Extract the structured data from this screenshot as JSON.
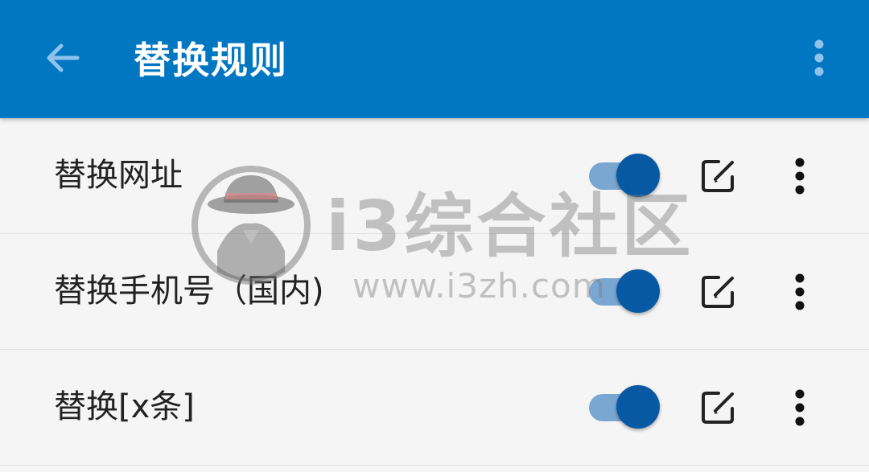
{
  "appbar": {
    "title": "替换规则",
    "back_icon": "arrow-left-icon",
    "overflow_icon": "more-vertical-icon",
    "color": "#0277c1"
  },
  "rules": [
    {
      "label": "替换网址",
      "enabled": true
    },
    {
      "label": "替换手机号（国内)",
      "enabled": true
    },
    {
      "label": "替换[x条]",
      "enabled": true
    }
  ],
  "row_icons": {
    "edit_icon": "edit-icon",
    "more_icon": "more-vertical-icon"
  },
  "switch_colors": {
    "track": "#7aa7d2",
    "thumb": "#0859a3"
  },
  "watermark": {
    "name": "i3综合社区",
    "url": "www.i3zh.com"
  }
}
